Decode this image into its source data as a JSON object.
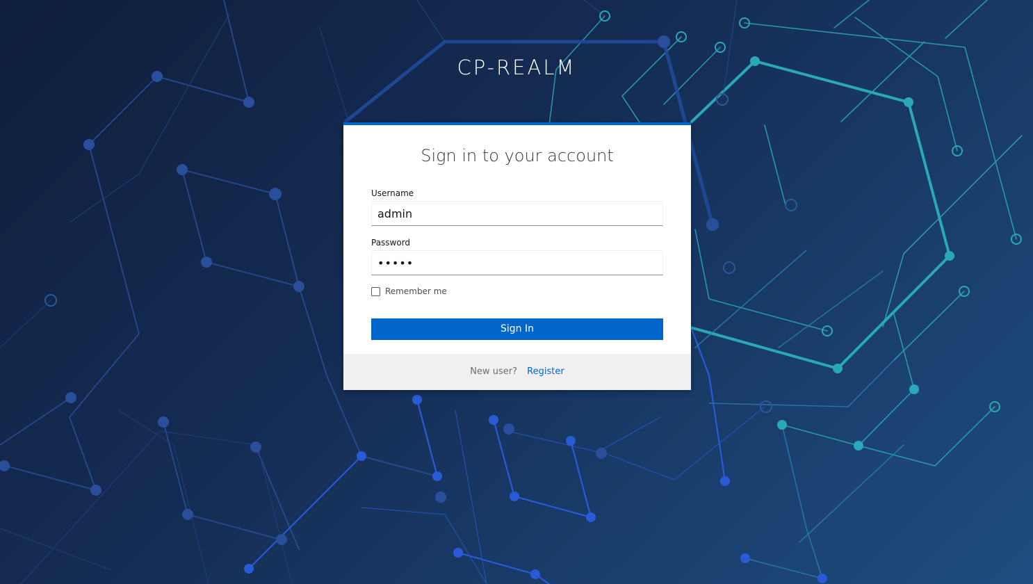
{
  "realm": {
    "title": "CP-REALM"
  },
  "login": {
    "heading": "Sign in to your account",
    "username": {
      "label": "Username",
      "value": "admin"
    },
    "password": {
      "label": "Password",
      "value": "•••••"
    },
    "remember_me": {
      "label": "Remember me",
      "checked": false
    },
    "submit_label": "Sign In"
  },
  "footer": {
    "prompt": "New user?",
    "register_label": "Register"
  },
  "colors": {
    "primary": "#0066cc",
    "background_dark": "#0f1f3c",
    "circuit_cyan": "#2aa8b8",
    "circuit_blue": "#2a5bd7"
  }
}
